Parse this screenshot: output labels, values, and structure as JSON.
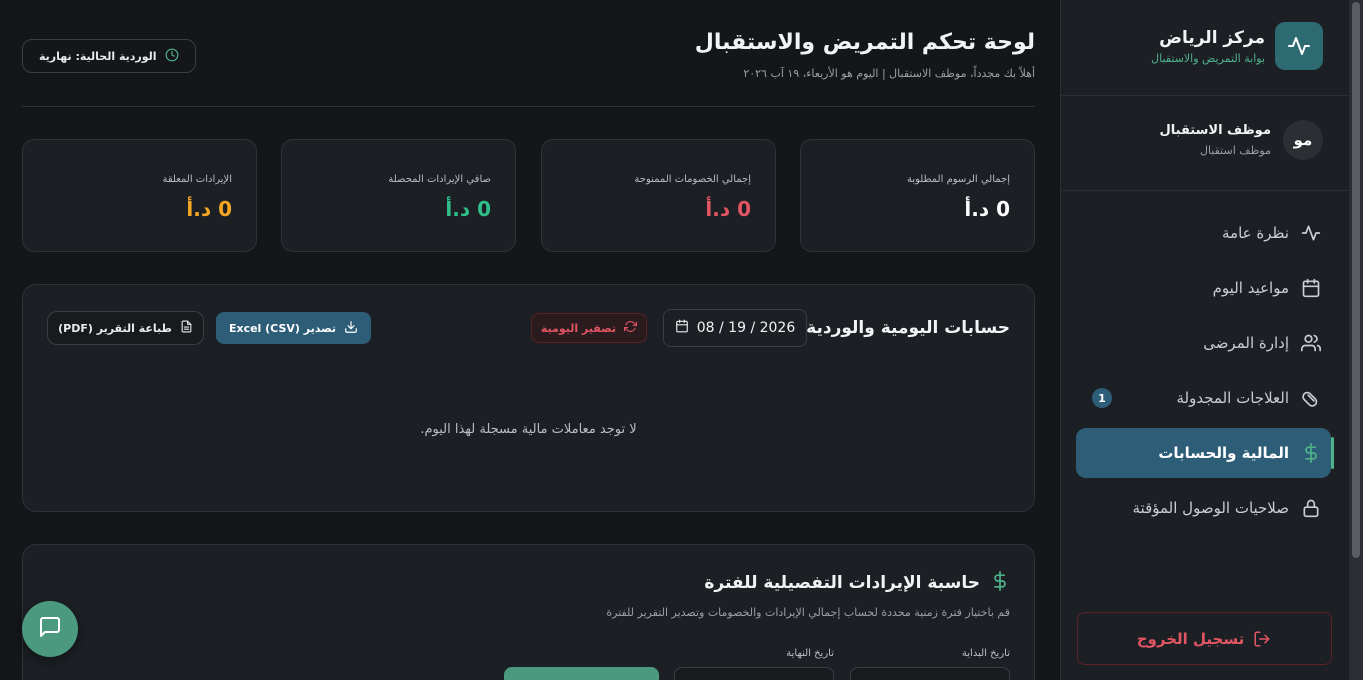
{
  "sidebar": {
    "brand_title": "مركز الرياض",
    "brand_subtitle": "بوابة التمريض والاستقبال",
    "user_initials": "مو",
    "user_name": "موظف الاستقبال",
    "user_role": "موظف استقبال",
    "items": [
      {
        "label": "نظرة عامة",
        "icon": "activity-icon"
      },
      {
        "label": "مواعيد اليوم",
        "icon": "calendar-icon"
      },
      {
        "label": "إدارة المرضى",
        "icon": "users-icon"
      },
      {
        "label": "العلاجات المجدولة",
        "icon": "pill-icon",
        "badge": "1"
      },
      {
        "label": "المالية والحسابات",
        "icon": "dollar-icon",
        "active": true
      },
      {
        "label": "صلاحيات الوصول المؤقتة",
        "icon": "lock-icon"
      }
    ],
    "logout_label": "تسجيل الخروج"
  },
  "header": {
    "title": "لوحة تحكم التمريض والاستقبال",
    "subtitle": "أهلاً بك مجدداً، موظف الاستقبال | اليوم هو الأربعاء، ١٩ آب ٢٠٢٦",
    "shift_label": "الوردية الحالية: نهارية"
  },
  "stats": [
    {
      "label": "إجمالي الرسوم المطلوبة",
      "value": "0 د.أ",
      "color": "#ffffff"
    },
    {
      "label": "إجمالي الخصومات الممنوحة",
      "value": "0 د.أ",
      "color": "#e25563"
    },
    {
      "label": "صافي الإيرادات المحصلة",
      "value": "0 د.أ",
      "color": "#2fc08a"
    },
    {
      "label": "الإيرادات المعلقة",
      "value": "0 د.أ",
      "color": "#f5a623"
    }
  ],
  "daily": {
    "title": "حسابات اليومية والوردية",
    "date": "08 / 19 / 2026",
    "reset_label": "تصفير اليومية",
    "export_label": "تصدير (Excel (CSV",
    "print_label": "طباعة التقرير (PDF)",
    "empty_message": "لا توجد معاملات مالية مسجلة لهذا اليوم."
  },
  "calculator": {
    "title": "حاسبة الإيرادات التفصيلية للفترة",
    "subtitle": "قم باختيار فترة زمنية محددة لحساب إجمالي الإيرادات والخصومات وتصدير التقرير للفترة",
    "start_label": "تاريخ البداية",
    "end_label": "تاريخ النهاية"
  },
  "colors": {
    "accent": "#2e5d78",
    "success": "#4fb38a",
    "danger": "#e25563"
  }
}
